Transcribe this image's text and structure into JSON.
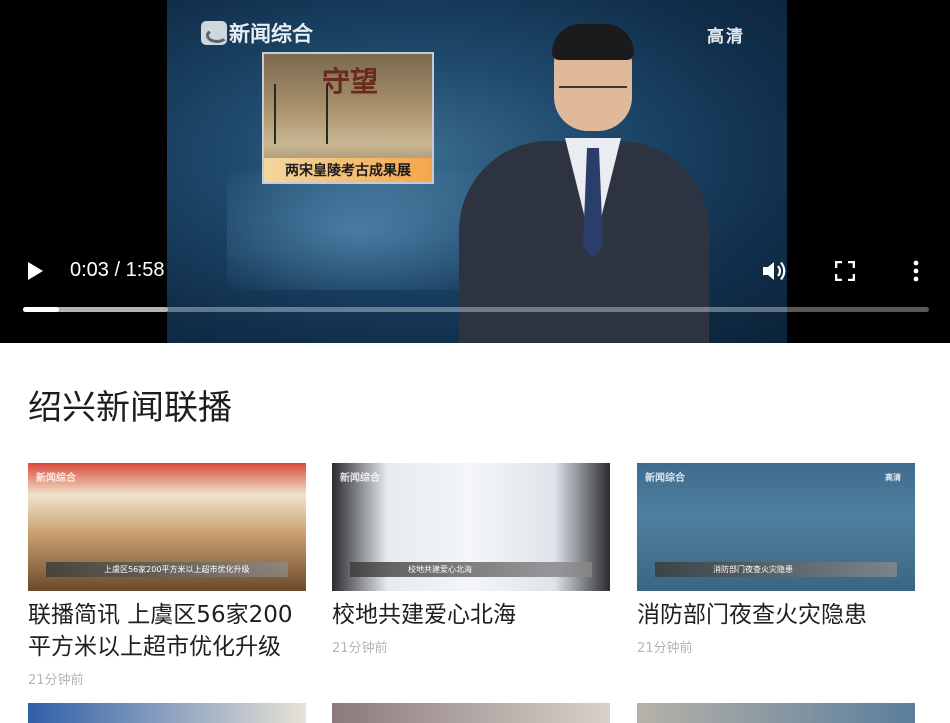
{
  "player": {
    "channel_logo_text": "新闻综合",
    "hd_badge": "高清",
    "inset_big_text": "守望",
    "inset_caption": "两宋皇陵考古成果展",
    "time_display": "0:03 / 1:58",
    "progress": {
      "played_fraction": 0.04,
      "buffered_fraction": 0.16
    },
    "icons": {
      "play": "play-icon",
      "volume": "volume-icon",
      "fullscreen": "fullscreen-icon",
      "more": "more-vertical-icon"
    }
  },
  "section": {
    "title": "绍兴新闻联播"
  },
  "cards": [
    {
      "title": "联播简讯 上虞区56家200平方米以上超市优化升级",
      "time": "21分钟前",
      "thumb_caption": "上虞区56家200平方米以上超市优化升级",
      "thumb_logo": "新闻综合"
    },
    {
      "title": "校地共建爱心北海",
      "time": "21分钟前",
      "thumb_caption": "校地共建爱心北海",
      "thumb_logo": "新闻综合"
    },
    {
      "title": "消防部门夜查火灾隐患",
      "time": "21分钟前",
      "thumb_caption": "消防部门夜查火灾隐患",
      "thumb_logo": "新闻综合",
      "thumb_hd": "高清"
    }
  ]
}
